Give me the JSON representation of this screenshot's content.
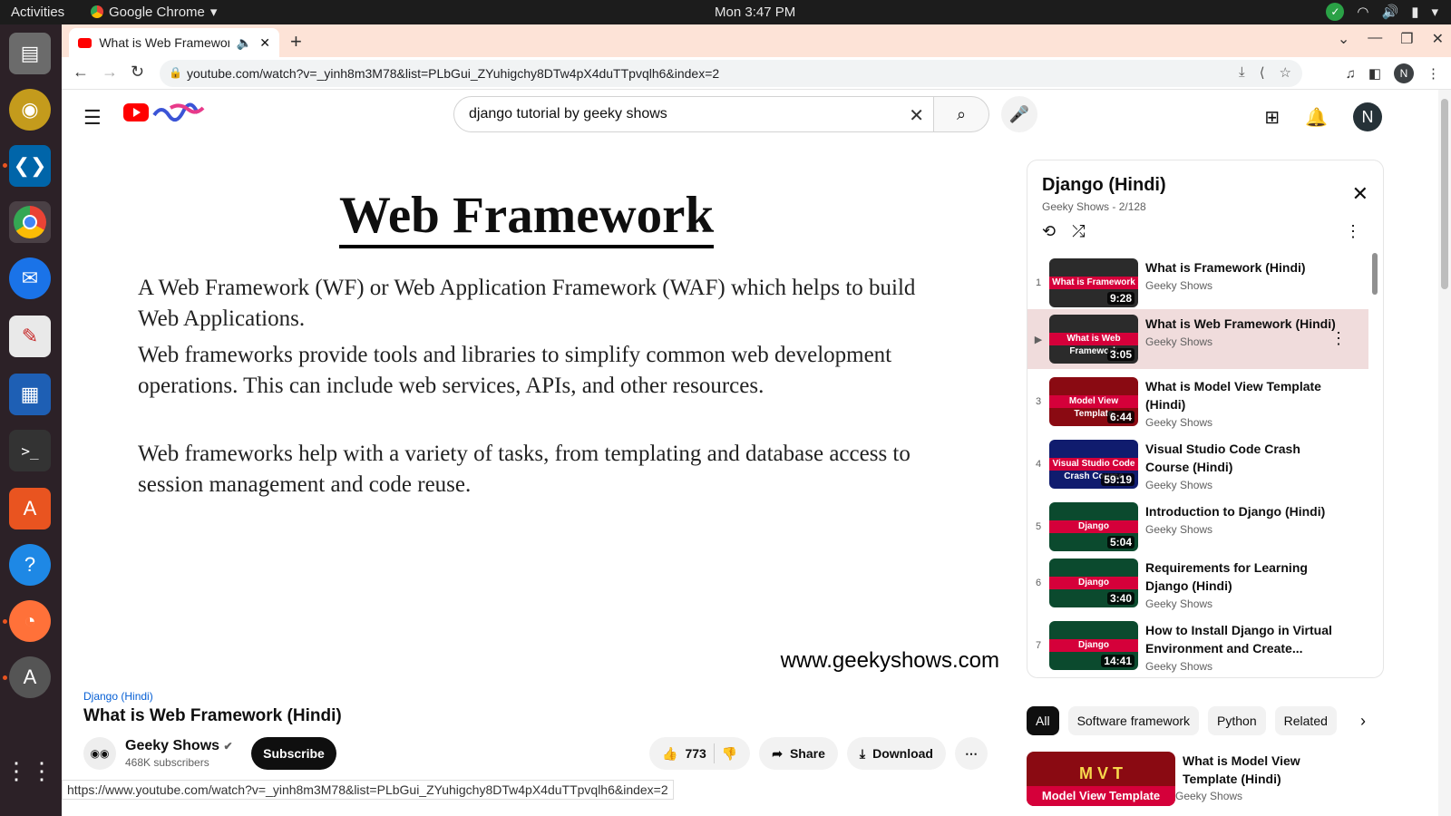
{
  "os": {
    "activities": "Activities",
    "app": "Google Chrome",
    "clock": "Mon  3:47 PM"
  },
  "browser": {
    "tab_title": "What is Web Framework",
    "url": "youtube.com/watch?v=_yinh8m3M78&list=PLbGui_ZYuhigchy8DTw4pX4duTTpvqlh6&index=2",
    "profile_initial": "N",
    "status_url": "https://www.youtube.com/watch?v=_yinh8m3M78&list=PLbGui_ZYuhigchy8DTw4pX4duTTpvqlh6&index=2"
  },
  "yt": {
    "search_value": "django tutorial by geeky shows",
    "avatar_initial": "N"
  },
  "video": {
    "slide_title": "Web Framework",
    "para1": "A Web Framework (WF) or Web Application Framework (WAF) which helps to build Web Applications.",
    "para2": "Web frameworks provide tools and libraries to simplify common web development operations. This can include web services, APIs, and other resources.",
    "para3": "Web frameworks help with a variety of tasks, from templating and database access to session management and code reuse.",
    "watermark": "www.geekyshows.com",
    "playlist_tag": "Django (Hindi)",
    "title": "What is Web Framework (Hindi)",
    "channel": "Geeky Shows",
    "subscribers": "468K subscribers",
    "subscribe": "Subscribe",
    "likes": "773",
    "share": "Share",
    "download": "Download"
  },
  "playlist": {
    "title": "Django (Hindi)",
    "sub": "Geeky Shows - 2/128",
    "items": [
      {
        "idx": "1",
        "title": "What is Framework (Hindi)",
        "channel": "Geeky Shows",
        "thumb": "What is Framework",
        "dur": "9:28",
        "bg": "#2b2b2b"
      },
      {
        "idx": "▶",
        "title": "What is Web Framework (Hindi)",
        "channel": "Geeky Shows",
        "thumb": "What is Web Framework",
        "dur": "3:05",
        "bg": "#2b2b2b"
      },
      {
        "idx": "3",
        "title": "What is Model View Template (Hindi)",
        "channel": "Geeky Shows",
        "thumb": "Model View Template",
        "dur": "6:44",
        "bg": "#8a0a12"
      },
      {
        "idx": "4",
        "title": "Visual Studio Code Crash Course (Hindi)",
        "channel": "Geeky Shows",
        "thumb": "Visual Studio Code Crash Course",
        "dur": "59:19",
        "bg": "#101c6e"
      },
      {
        "idx": "5",
        "title": "Introduction to Django (Hindi)",
        "channel": "Geeky Shows",
        "thumb": "Django",
        "dur": "5:04",
        "bg": "#0b4a2e"
      },
      {
        "idx": "6",
        "title": "Requirements for Learning Django (Hindi)",
        "channel": "Geeky Shows",
        "thumb": "Django",
        "dur": "3:40",
        "bg": "#0b4a2e"
      },
      {
        "idx": "7",
        "title": "How to Install Django in Virtual Environment and Create...",
        "channel": "Geeky Shows",
        "thumb": "Django",
        "dur": "14:41",
        "bg": "#0b4a2e"
      }
    ]
  },
  "chips": [
    "All",
    "Software framework",
    "Python",
    "Related"
  ],
  "rec": {
    "title": "What is Model View Template (Hindi)",
    "channel": "Geeky Shows",
    "thumb_top": "M V T",
    "thumb_label": "Model View Template"
  }
}
